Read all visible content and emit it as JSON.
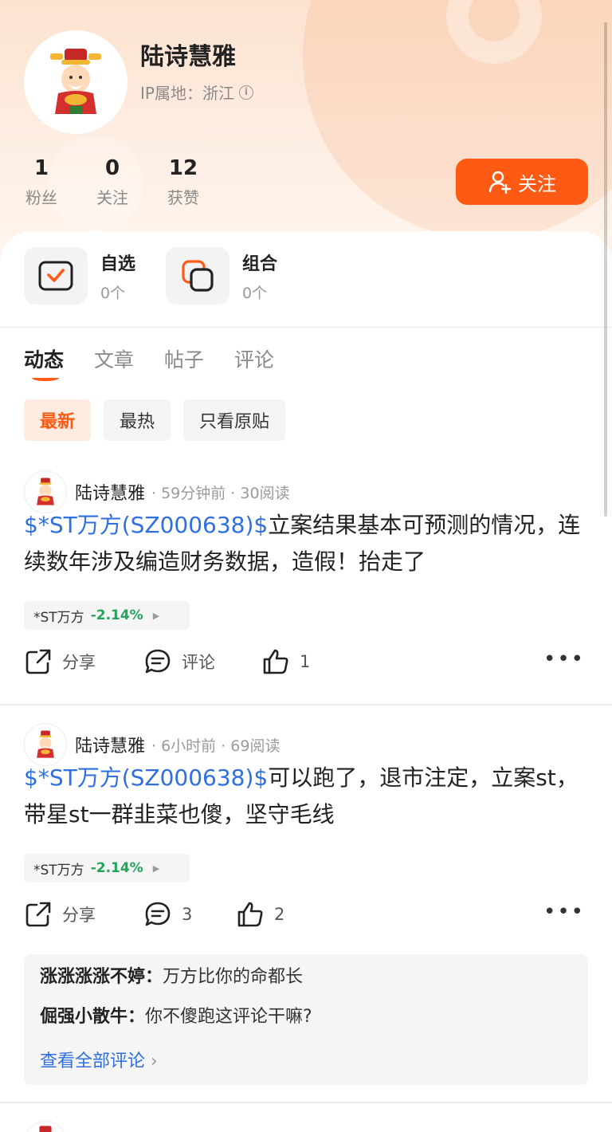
{
  "profile": {
    "name": "陆诗慧雅",
    "ip_label": "IP属地：浙江",
    "stats": [
      {
        "num": "1",
        "label": "粉丝"
      },
      {
        "num": "0",
        "label": "关注"
      },
      {
        "num": "12",
        "label": "获赞"
      }
    ],
    "follow_label": "关注"
  },
  "quick": [
    {
      "title": "自选",
      "count": "0个",
      "icon": "checkbox-icon"
    },
    {
      "title": "组合",
      "count": "0个",
      "icon": "layers-icon"
    }
  ],
  "tabs": [
    "动态",
    "文章",
    "帖子",
    "评论"
  ],
  "filters": [
    "最新",
    "最热",
    "只看原贴"
  ],
  "colors": {
    "accent": "#ff5a14",
    "link": "#2f6fe0",
    "down": "#22a45a"
  },
  "posts": [
    {
      "author": "陆诗慧雅",
      "meta": "· 59分钟前 · 30阅读",
      "stock_link": "$*ST万方(SZ000638)$",
      "text": "立案结果基本可预测的情况，连续数年涉及编造财务数据，造假！抬走了",
      "tag": {
        "name": "*ST万方",
        "pct": "-2.14%"
      },
      "share": "分享",
      "comment": "评论",
      "likes": "1"
    },
    {
      "author": "陆诗慧雅",
      "meta": "· 6小时前 · 69阅读",
      "stock_link": "$*ST万方(SZ000638)$",
      "text": "可以跑了，退市注定，立案st，带星st一群韭菜也傻，坚守毛线",
      "tag": {
        "name": "*ST万方",
        "pct": "-2.14%"
      },
      "share": "分享",
      "comment": "3",
      "likes": "2",
      "comments": [
        {
          "name": "涨涨涨涨不婷：",
          "text": "万方比你的命都长"
        },
        {
          "name": "倔强小散牛：",
          "text": "你不傻跑这评论干嘛?"
        }
      ],
      "view_all": "查看全部评论"
    }
  ]
}
